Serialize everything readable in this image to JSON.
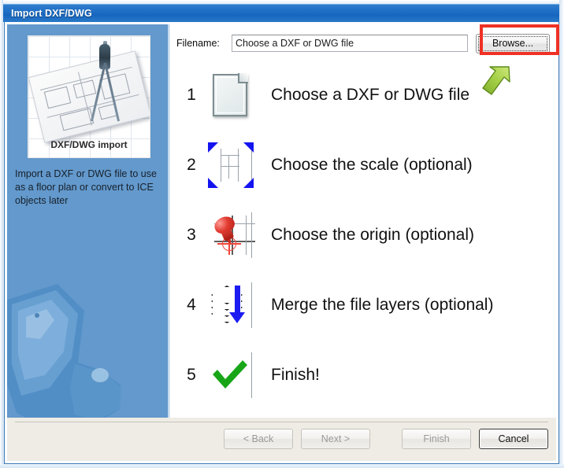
{
  "window": {
    "title": "Import DXF/DWG"
  },
  "sidepanel": {
    "thumbnail_caption": "DXF/DWG import",
    "thumbnail_icon": "drafting-compass-floorplan-image",
    "description": "Import a DXF or DWG file to use as a floor plan or convert to ICE objects later",
    "decoration_icon": "melting-ice-cube-graphic"
  },
  "filename": {
    "label": "Filename:",
    "value": "Choose a DXF or DWG file",
    "placeholder": "Choose a DXF or DWG file",
    "browse_label": "Browse..."
  },
  "steps": [
    {
      "number": "1",
      "label": "Choose a DXF or DWG file",
      "icon": "document-icon"
    },
    {
      "number": "2",
      "label": "Choose the scale (optional)",
      "icon": "scale-resize-icon"
    },
    {
      "number": "3",
      "label": "Choose the origin (optional)",
      "icon": "pushpin-origin-icon"
    },
    {
      "number": "4",
      "label": "Merge the file layers (optional)",
      "icon": "merge-layers-icon"
    },
    {
      "number": "5",
      "label": "Finish!",
      "icon": "green-checkmark-icon"
    }
  ],
  "footer": {
    "back_label": "< Back",
    "next_label": "Next >",
    "finish_label": "Finish",
    "cancel_label": "Cancel"
  },
  "annotations": {
    "highlight_color": "#ee3124",
    "arrow_color": "#9bc83a",
    "highlight_target": "browse-button",
    "arrow_target": "browse-button"
  },
  "colors": {
    "titlebar": "#1f6fc6",
    "sidepanel": "#6399cc",
    "footer": "#efece6",
    "accent_blue": "#3c78b4"
  }
}
